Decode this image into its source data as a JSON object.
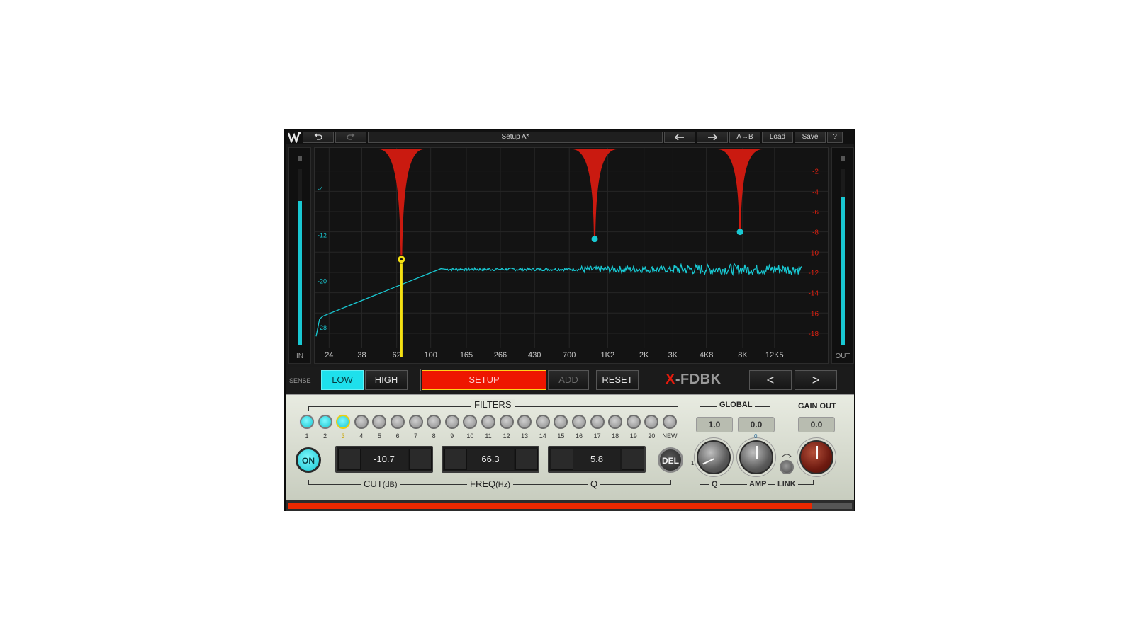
{
  "toolbar": {
    "undo_icon": "undo-icon",
    "redo_icon": "redo-icon",
    "preset_name": "Setup A*",
    "prev_preset_icon": "arrow-left-icon",
    "next_preset_icon": "arrow-right-icon",
    "ab_label": "A→B",
    "load_label": "Load",
    "save_label": "Save",
    "help_label": "?"
  },
  "meters": {
    "in_label": "IN",
    "out_label": "OUT",
    "in_level": 0.82,
    "out_level": 0.84
  },
  "graph": {
    "freq_ticks": [
      "24",
      "38",
      "62",
      "100",
      "165",
      "266",
      "430",
      "700",
      "1K2",
      "2K",
      "3K",
      "4K8",
      "8K",
      "12K5"
    ],
    "input_scale": [
      "-4",
      "-12",
      "-20",
      "-28"
    ],
    "output_scale": [
      "-2",
      "-4",
      "-6",
      "-8",
      "-10",
      "-12",
      "-14",
      "-16",
      "-18"
    ],
    "notches": [
      {
        "freq": 66.3,
        "cut_db": -10.7,
        "selected": true
      },
      {
        "freq": 1000,
        "cut_db": -8.7,
        "selected": false
      },
      {
        "freq": 7700,
        "cut_db": -8.0,
        "selected": false
      }
    ],
    "colors": {
      "notch": "#d41a10",
      "spectrum": "#19c8d2",
      "selected": "#f4e012"
    }
  },
  "controls": {
    "sense_label": "SENSE",
    "low_label": "LOW",
    "high_label": "HIGH",
    "setup_label": "SETUP",
    "add_label": "ADD",
    "reset_label": "RESET",
    "product_x": "X",
    "product_rest": "-FDBK",
    "prev_label": "<",
    "next_label": ">"
  },
  "filters": {
    "title": "FILTERS",
    "items": [
      {
        "label": "1",
        "active": true,
        "selected": false
      },
      {
        "label": "2",
        "active": true,
        "selected": false
      },
      {
        "label": "3",
        "active": true,
        "selected": true
      },
      {
        "label": "4",
        "active": false,
        "selected": false
      },
      {
        "label": "5",
        "active": false,
        "selected": false
      },
      {
        "label": "6",
        "active": false,
        "selected": false
      },
      {
        "label": "7",
        "active": false,
        "selected": false
      },
      {
        "label": "8",
        "active": false,
        "selected": false
      },
      {
        "label": "9",
        "active": false,
        "selected": false
      },
      {
        "label": "10",
        "active": false,
        "selected": false
      },
      {
        "label": "11",
        "active": false,
        "selected": false
      },
      {
        "label": "12",
        "active": false,
        "selected": false
      },
      {
        "label": "13",
        "active": false,
        "selected": false
      },
      {
        "label": "14",
        "active": false,
        "selected": false
      },
      {
        "label": "15",
        "active": false,
        "selected": false
      },
      {
        "label": "16",
        "active": false,
        "selected": false
      },
      {
        "label": "17",
        "active": false,
        "selected": false
      },
      {
        "label": "18",
        "active": false,
        "selected": false
      },
      {
        "label": "19",
        "active": false,
        "selected": false
      },
      {
        "label": "20",
        "active": false,
        "selected": false
      },
      {
        "label": "NEW",
        "active": false,
        "selected": false
      }
    ],
    "on_label": "ON",
    "del_label": "DEL",
    "cut_value": "-10.7",
    "freq_value": "66.3",
    "q_value": "5.8",
    "cut_label": "CUT",
    "cut_unit": "(dB)",
    "freq_label": "FREQ",
    "freq_unit": "(Hz)",
    "q_label": "Q"
  },
  "global": {
    "title": "GLOBAL",
    "q_value": "1.0",
    "amp_value": "0.0",
    "q_label": "Q",
    "amp_label": "AMP",
    "link_label": "LINK",
    "amp_zero": "0",
    "q_min": "1"
  },
  "gain_out": {
    "title": "GAIN OUT",
    "value": "0.0"
  },
  "bottom_meter": {
    "level": 0.93
  }
}
